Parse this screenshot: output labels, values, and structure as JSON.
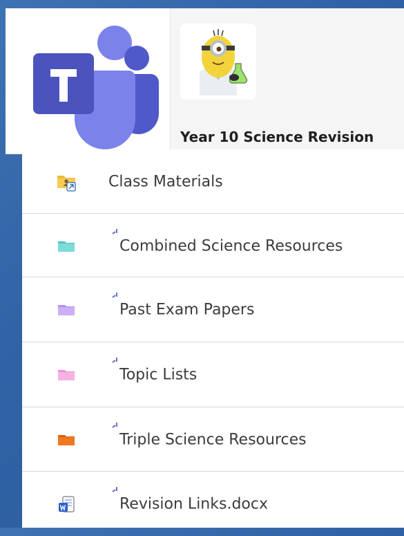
{
  "team": {
    "name": "Year 10 Science Revision"
  },
  "icons": {
    "app_logo": "microsoft-teams-logo",
    "team_avatar": "minion-scientist-avatar"
  },
  "files": [
    {
      "name": "Class Materials",
      "icon": "shared-folder-icon",
      "color": "#f2c94c",
      "new_indicator": false
    },
    {
      "name": "Combined Science Resources",
      "icon": "folder-icon",
      "color": "#6fd3cf",
      "new_indicator": true
    },
    {
      "name": "Past Exam Papers",
      "icon": "folder-icon",
      "color": "#c7a4f4",
      "new_indicator": true
    },
    {
      "name": "Topic Lists",
      "icon": "folder-icon",
      "color": "#f6a4dd",
      "new_indicator": true
    },
    {
      "name": "Triple Science Resources",
      "icon": "folder-icon",
      "color": "#f0781e",
      "new_indicator": true
    },
    {
      "name": "Revision Links.docx",
      "icon": "word-document-icon",
      "color": "#2b5fc9",
      "new_indicator": true
    }
  ]
}
